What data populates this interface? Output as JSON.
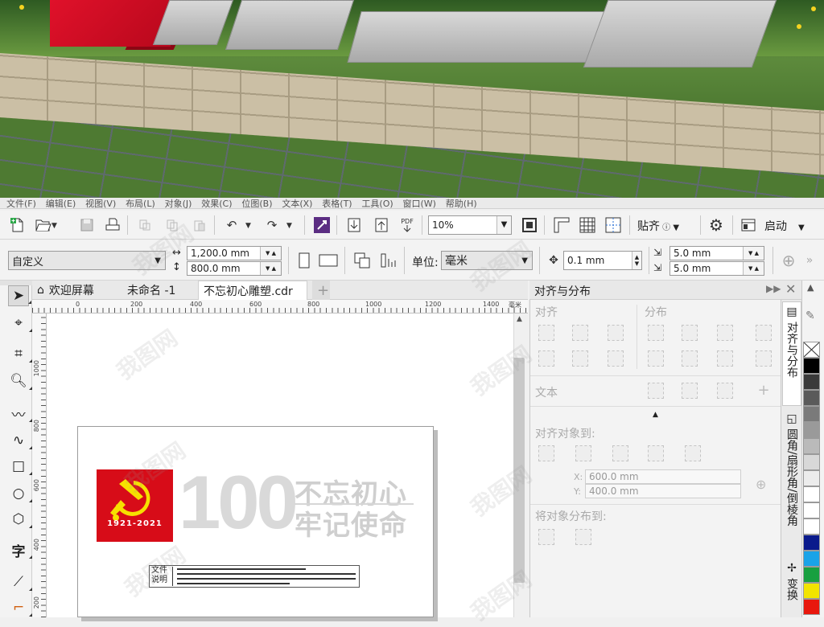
{
  "menu": {
    "items": [
      "文件(F)",
      "编辑(E)",
      "视图(V)",
      "布局(L)",
      "对象(J)",
      "效果(C)",
      "位图(B)",
      "文本(X)",
      "表格(T)",
      "工具(O)",
      "窗口(W)",
      "帮助(H)"
    ]
  },
  "toolbar1": {
    "pdf_label": "PDF",
    "zoom_value": "10%",
    "snap_label": "贴齐",
    "launch_label": "启动"
  },
  "toolbar2": {
    "preset_value": "自定义",
    "width_value": "1,200.0 mm",
    "height_value": "800.0 mm",
    "units_label": "单位:",
    "units_value": "毫米",
    "nudge_value": "0.1 mm",
    "dup_x_value": "5.0 mm",
    "dup_y_value": "5.0 mm"
  },
  "tabs": {
    "welcome": "欢迎屏幕",
    "untitled": "未命名 -1",
    "active_doc": "不忘初心雕塑.cdr",
    "add": "+"
  },
  "ruler": {
    "h_labels": [
      "0",
      "200",
      "400",
      "600",
      "800",
      "1000",
      "1200",
      "1400"
    ],
    "h_unit": "毫米",
    "v_labels": [
      "1000",
      "800",
      "600",
      "400",
      "200"
    ]
  },
  "design": {
    "emblem_years": "1921-2021",
    "big_number": "100",
    "slogan_line1": "不忘初心",
    "slogan_line2": "牢记使命",
    "note_label_line1": "文件",
    "note_label_line2": "说明"
  },
  "docker": {
    "title": "对齐与分布",
    "section_align": "对齐",
    "section_distribute": "分布",
    "section_text": "文本",
    "section_align_to": "对齐对象到:",
    "x_label": "X:",
    "x_value": "600.0 mm",
    "y_label": "Y:",
    "y_value": "400.0 mm",
    "section_distribute_to": "将对象分布到:"
  },
  "vertical_tabs": {
    "tab1": "对齐与分布",
    "tab2": "圆角/扇形角/倒棱角",
    "tab3": "变换"
  },
  "palette": {
    "colors": [
      "#ffffff",
      "#000000",
      "#3a3a3a",
      "#5a5a5a",
      "#7a7a7a",
      "#9a9a9a",
      "#bababa",
      "#d8d8d8",
      "#ffffff",
      "#0000c8",
      "#1aa3e8",
      "#18a040",
      "#f2e400",
      "#e8170d"
    ]
  },
  "watermark": "我图网"
}
